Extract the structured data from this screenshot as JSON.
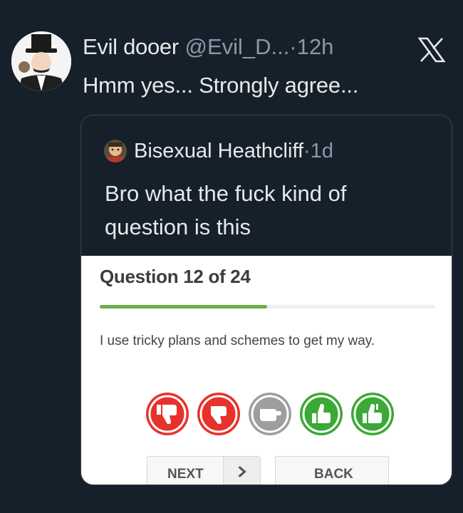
{
  "post": {
    "author_name": "Evil dooer",
    "handle": "@Evil_D...",
    "separator": "·",
    "time": "12h",
    "text": "Hmm yes... Strongly agree...",
    "avatar_icon": "top-hat-villain-avatar",
    "close_icon": "x-logo-icon"
  },
  "quoted": {
    "author_name": "Bisexual Heathcliff",
    "separator": "·",
    "time": "1d",
    "text": "Bro what the fuck kind of question is this",
    "avatar_icon": "comic-avatar"
  },
  "quiz": {
    "title": "Question 12 of 24",
    "progress": 0.5,
    "question": "I use tricky plans and schemes to get my way.",
    "answers": [
      {
        "name": "strongly-disagree",
        "color": "#e8312b",
        "icon": "thumbs-down-icon"
      },
      {
        "name": "disagree",
        "color": "#e8312b",
        "icon": "thumbs-down-icon"
      },
      {
        "name": "neutral",
        "color": "#9e9e9e",
        "icon": "hand-pointing-icon"
      },
      {
        "name": "agree",
        "color": "#3aa935",
        "icon": "thumbs-up-icon"
      },
      {
        "name": "strongly-agree",
        "color": "#3aa935",
        "icon": "thumbs-up-icon"
      }
    ],
    "next_label": "NEXT",
    "back_label": "BACK",
    "next_arrow_icon": "chevron-right-icon"
  },
  "colors": {
    "background": "#15202b",
    "text": "#e7e9ea",
    "muted": "#8b98a5",
    "progress": "#6ab04c"
  }
}
